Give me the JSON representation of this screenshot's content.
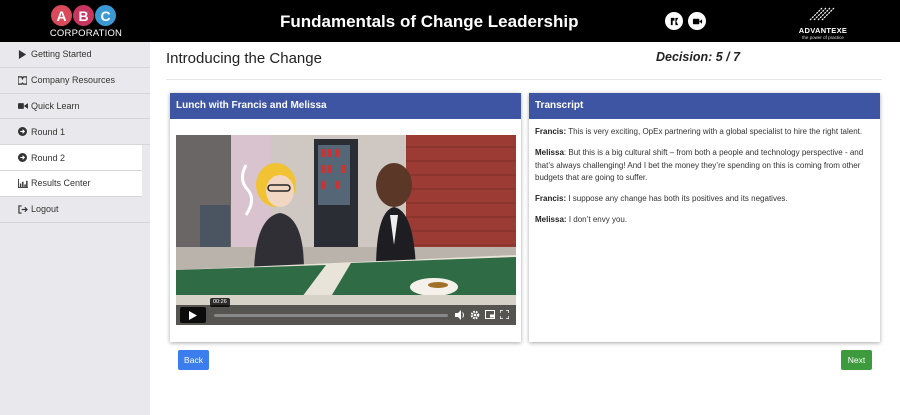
{
  "header": {
    "logo_letters": [
      "A",
      "B",
      "C"
    ],
    "logo_colors": [
      "#d94a5b",
      "#c7365e",
      "#3b99d4"
    ],
    "logo_text": "CORPORATION",
    "title": "Fundamentals of Change Leadership",
    "media_icons": [
      "captions-icon",
      "video-camera-icon"
    ],
    "brand_name": "ADVANTEXE",
    "brand_tagline": "the power of practice"
  },
  "sidebar": {
    "items": [
      {
        "label": "Getting Started",
        "icon": "play-icon"
      },
      {
        "label": "Company Resources",
        "icon": "book-icon"
      },
      {
        "label": "Quick Learn",
        "icon": "video-icon"
      },
      {
        "label": "Round 1",
        "icon": "arrow-circle-icon"
      },
      {
        "label": "Round 2",
        "icon": "arrow-circle-icon",
        "active": true
      },
      {
        "label": "Results Center",
        "icon": "chart-icon",
        "active": true
      },
      {
        "label": "Logout",
        "icon": "logout-icon"
      }
    ]
  },
  "main": {
    "title": "Introducing the Change",
    "decision": "Decision: 5 / 7",
    "video_card": {
      "header": "Lunch with Francis and Melissa",
      "time": "00:26",
      "progress": 0.0
    },
    "transcript": {
      "header": "Transcript",
      "lines": [
        {
          "speaker": "Francis:",
          "text": "This is very exciting, OpEx partnering with a global specialist to hire the right talent."
        },
        {
          "speaker": "Melissa",
          "text": ": But this is a big cultural shift – from both a people and technology perspective - and that’s always challenging! And I bet the money they’re spending on this is coming from other budgets that are going to suffer."
        },
        {
          "speaker": "Francis:",
          "text": "I suppose any change has both its positives and its negatives."
        },
        {
          "speaker": "Melissa:",
          "text": "I don’t envy you."
        }
      ]
    },
    "back_label": "Back",
    "next_label": "Next"
  },
  "colors": {
    "card_header": "#3e55a3",
    "back_button": "#3b7ded",
    "next_button": "#3d9b3d",
    "sidebar_bg": "#e9e9ed"
  }
}
